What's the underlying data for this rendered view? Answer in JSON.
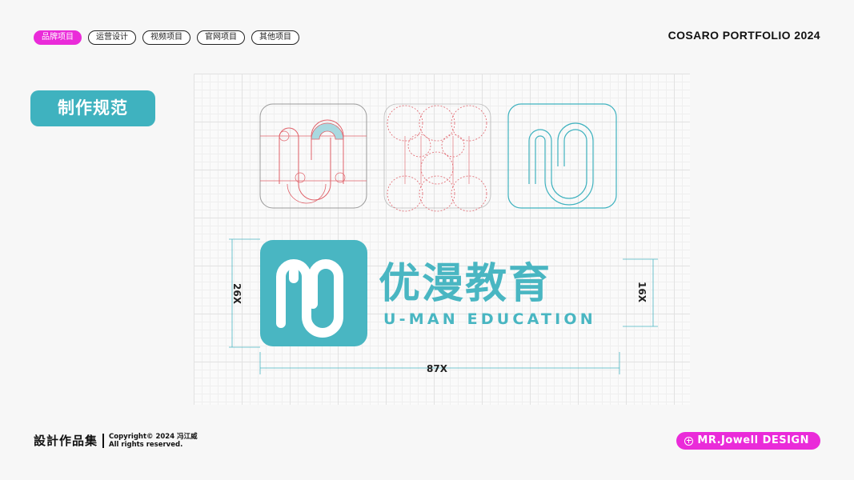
{
  "nav": {
    "tabs": [
      {
        "label": "品牌项目",
        "active": true
      },
      {
        "label": "运营设计",
        "active": false
      },
      {
        "label": "视频项目",
        "active": false
      },
      {
        "label": "官网项目",
        "active": false
      },
      {
        "label": "其他项目",
        "active": false
      }
    ]
  },
  "header": {
    "portfolio_title": "COSARO PORTFOLIO 2024"
  },
  "section": {
    "title": "制作规范"
  },
  "logo": {
    "name_cn": "优漫教育",
    "name_en": "U-MAN EDUCATION",
    "dimensions": {
      "height": "26X",
      "text_height": "16X",
      "width": "87X"
    }
  },
  "footer": {
    "title": "設計作品集",
    "copyright": "Copyright© 2024 冯江威",
    "rights": "All rights reserved.",
    "brand": "MR.Jowell DESIGN"
  },
  "colors": {
    "accent": "#ea2bd9",
    "teal": "#3fb2bf",
    "construction_red": "#e0626a"
  },
  "icons": [
    "plus-circle-icon",
    "logo-mark-icon"
  ]
}
